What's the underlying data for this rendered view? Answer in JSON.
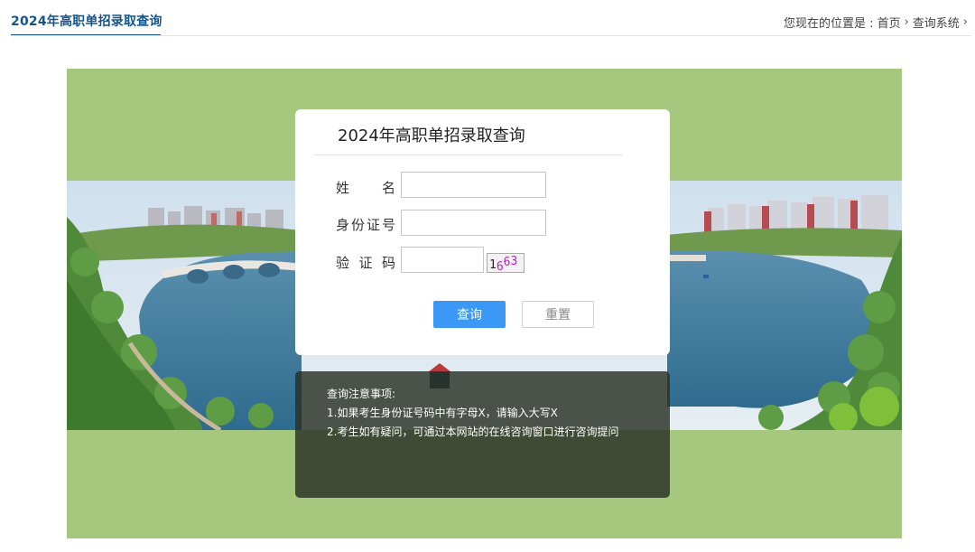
{
  "header": {
    "title": "2024年高职单招录取查询",
    "breadcrumb": {
      "prefix": "您现在的位置是 :",
      "items": [
        "首页",
        "查询系统"
      ]
    }
  },
  "form": {
    "title": "2024年高职单招录取查询",
    "name_label": [
      "姓",
      "名"
    ],
    "id_label": [
      "身",
      "份",
      "证",
      "号"
    ],
    "captcha_label": [
      "验",
      "证",
      "码"
    ],
    "name_value": "",
    "id_value": "",
    "captcha_value": "",
    "captcha_text": "1663",
    "submit_label": "查询",
    "reset_label": "重置"
  },
  "notice": {
    "heading": "查询注意事项:",
    "items": [
      "1.如果考生身份证号码中有字母X，请输入大写X",
      "2.考生如有疑问，可通过本网站的在线咨询窗口进行咨询提问"
    ]
  },
  "colors": {
    "brand": "#13558f",
    "banner_green": "#a5c87e",
    "button_blue": "#3b98f5",
    "captcha_magenta": "#c21bd0"
  }
}
